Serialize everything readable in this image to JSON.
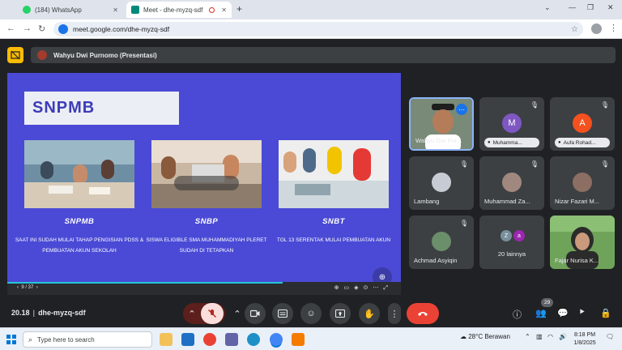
{
  "browser": {
    "tabs": [
      {
        "title": "(184) WhatsApp",
        "close": "✕"
      },
      {
        "title": "Meet - dhe-myzq-sdf",
        "close": "✕"
      }
    ],
    "new_tab": "+",
    "window_controls": [
      "⌄",
      "—",
      "❐",
      "✕"
    ],
    "url": "meet.google.com/dhe-myzq-sdf"
  },
  "meet": {
    "presenter_label": "Wahyu Dwi Purnomo (Presentasi)",
    "slide": {
      "title": "SNPMB",
      "columns": [
        {
          "heading": "SNPMB",
          "body": "SAAT INI SUDAH MULAI TAHAP PENGISIAN PDSS & PEMBUATAN AKUN SEKOLAH"
        },
        {
          "heading": "SNBP",
          "body": "SISWA ELIGIBLE SMA MUHAMMADIYAH PLERET SUDAH DI TETAPKAN"
        },
        {
          "heading": "SNBT",
          "body": "TGL 13 SERENTAK MULAI PEMBUATAN AKUN"
        }
      ],
      "pager": "9 / 37"
    },
    "participants": [
      {
        "name": "Wahyu Dwi Pur...",
        "avatar": "",
        "color": "#6d4c41"
      },
      {
        "name": "Muhamma...",
        "avatar": "M",
        "color": "#7e57c2"
      },
      {
        "name": "Aufa Rohad...",
        "avatar": "A",
        "color": "#f4511e"
      },
      {
        "name": "Lambang",
        "avatar": "",
        "color": "#c7ccd4"
      },
      {
        "name": "Muhammad Za...",
        "avatar": "",
        "color": "#a1887f"
      },
      {
        "name": "Nizar Fazari M...",
        "avatar": "",
        "color": "#8d6e63"
      },
      {
        "name": "Achmad Asyiqin",
        "avatar": "",
        "color": "#6b8e6b"
      },
      {
        "name": "20 lainnya",
        "avatar": "",
        "color": "#5f6368"
      },
      {
        "name": "Fajar Nurisa K...",
        "avatar": "",
        "color": "#6fa35a"
      }
    ],
    "others_avatars": [
      "Z",
      "a"
    ],
    "meeting_time": "20.18",
    "meeting_code": "dhe-myzq-sdf",
    "people_count": "29"
  },
  "taskbar": {
    "search_placeholder": "Type here to search",
    "weather": "28°C  Berawan",
    "time": "8:18 PM",
    "date": "1/8/2025"
  }
}
